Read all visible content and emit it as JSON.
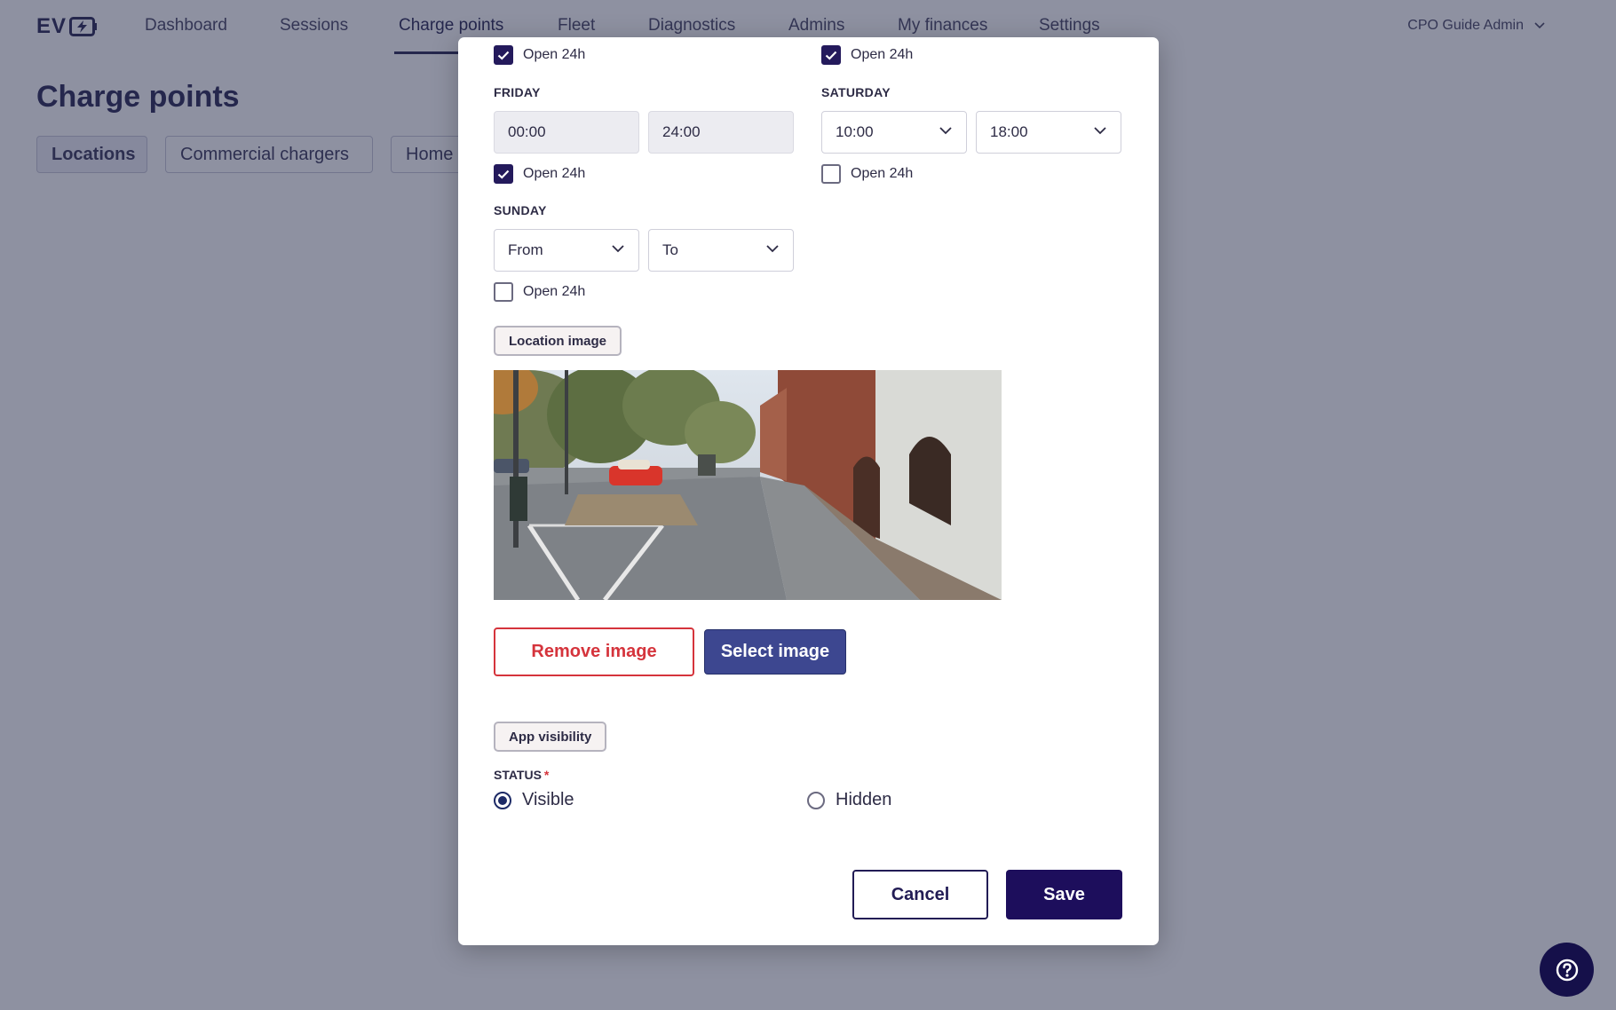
{
  "app": {
    "logo_text": "EV"
  },
  "nav": {
    "items": [
      "Dashboard",
      "Sessions",
      "Charge points",
      "Fleet",
      "Diagnostics",
      "Admins",
      "My finances",
      "Settings"
    ],
    "active": "Charge points",
    "user": "CPO Guide Admin"
  },
  "page": {
    "title": "Charge points",
    "tabs": [
      "Locations",
      "Commercial chargers",
      "Home"
    ]
  },
  "modal": {
    "thursday": {
      "open24h_label": "Open 24h",
      "open24h": true
    },
    "tuesday_right": {
      "open24h_label": "Open 24h",
      "open24h": true
    },
    "friday": {
      "label": "FRIDAY",
      "from": "00:00",
      "to": "24:00",
      "open24h_label": "Open 24h",
      "open24h": true
    },
    "saturday": {
      "label": "SATURDAY",
      "from": "10:00",
      "to": "18:00",
      "open24h_label": "Open 24h",
      "open24h": false
    },
    "sunday": {
      "label": "SUNDAY",
      "from_placeholder": "From",
      "to_placeholder": "To",
      "open24h_label": "Open 24h",
      "open24h": false
    },
    "image_section": {
      "chip": "Location image",
      "remove_label": "Remove image",
      "select_label": "Select image"
    },
    "visibility_section": {
      "chip": "App visibility",
      "status_label": "STATUS",
      "required_mark": "*",
      "options": [
        "Visible",
        "Hidden"
      ],
      "selected": "Visible"
    },
    "footer": {
      "cancel_label": "Cancel",
      "save_label": "Save"
    }
  },
  "colors": {
    "primary": "#1d0e5c",
    "accent_blue": "#3d4790",
    "danger": "#d5343c",
    "checkbox": "#241a5c"
  },
  "icons": {
    "help": "help-circle-icon",
    "chevron": "chevron-down-icon",
    "check": "check-icon"
  }
}
